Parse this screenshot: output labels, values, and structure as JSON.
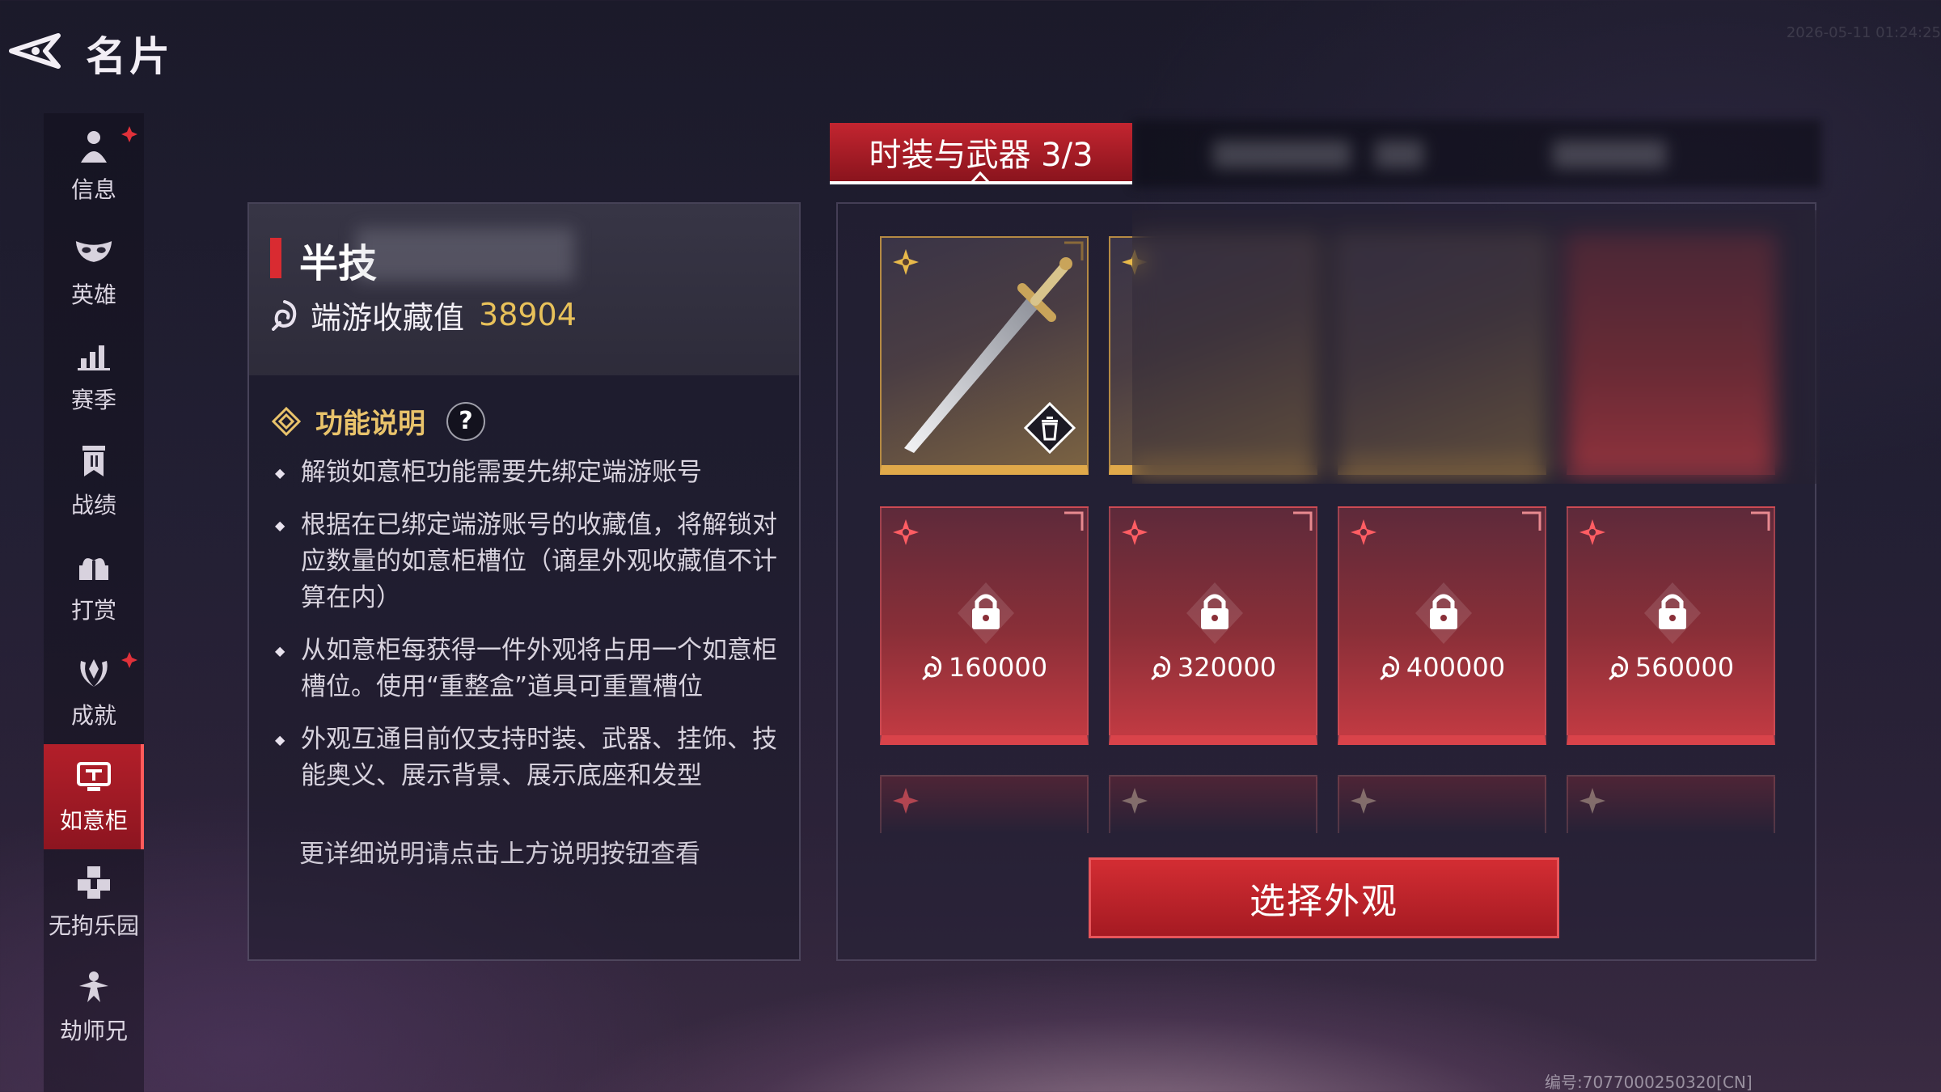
{
  "header": {
    "title": "名片",
    "timestamp": "2026-05-11 01:24:25"
  },
  "sidebar": {
    "items": [
      {
        "label": "信息",
        "icon": "user-icon",
        "badge": true
      },
      {
        "label": "英雄",
        "icon": "mask-icon",
        "badge": false
      },
      {
        "label": "赛季",
        "icon": "bar-chart-icon",
        "badge": false
      },
      {
        "label": "战绩",
        "icon": "banner-icon",
        "badge": false
      },
      {
        "label": "打赏",
        "icon": "gift-icon",
        "badge": false
      },
      {
        "label": "成就",
        "icon": "laurel-icon",
        "badge": true
      },
      {
        "label": "如意柜",
        "icon": "cabinet-icon",
        "badge": false,
        "active": true
      },
      {
        "label": "无拘乐园",
        "icon": "cubes-icon",
        "badge": false
      },
      {
        "label": "劫师兄",
        "icon": "figure-icon",
        "badge": false
      }
    ]
  },
  "profile": {
    "name": "半技",
    "collection_label": "端游收藏值",
    "collection_value": "38904"
  },
  "function_info": {
    "title": "功能说明",
    "help_label": "?",
    "bullets": [
      "解锁如意柜功能需要先绑定端游账号",
      "根据在已绑定端游账号的收藏值，将解锁对应数量的如意柜槽位（谪星外观收藏值不计算在内）",
      "从如意柜每获得一件外观将占用一个如意柜槽位。使用“重整盒”道具可重置槽位",
      "外观互通目前仅支持时装、武器、挂饰、技能奥义、展示背景、展示底座和发型"
    ],
    "more_note": "更详细说明请点击上方说明按钮查看"
  },
  "wardrobe": {
    "tab_label": "时装与武器 3/3",
    "locked_slots": [
      {
        "price": "160000"
      },
      {
        "price": "320000"
      },
      {
        "price": "400000"
      },
      {
        "price": "560000"
      }
    ],
    "select_button": "选择外观"
  },
  "footer": {
    "id_text": "编号:7077000250320[CN]"
  },
  "colors": {
    "accent_red": "#c32530",
    "gold": "#e8c15a",
    "locked_slot": "#c13a42",
    "unlocked_border": "#e0a94a"
  }
}
